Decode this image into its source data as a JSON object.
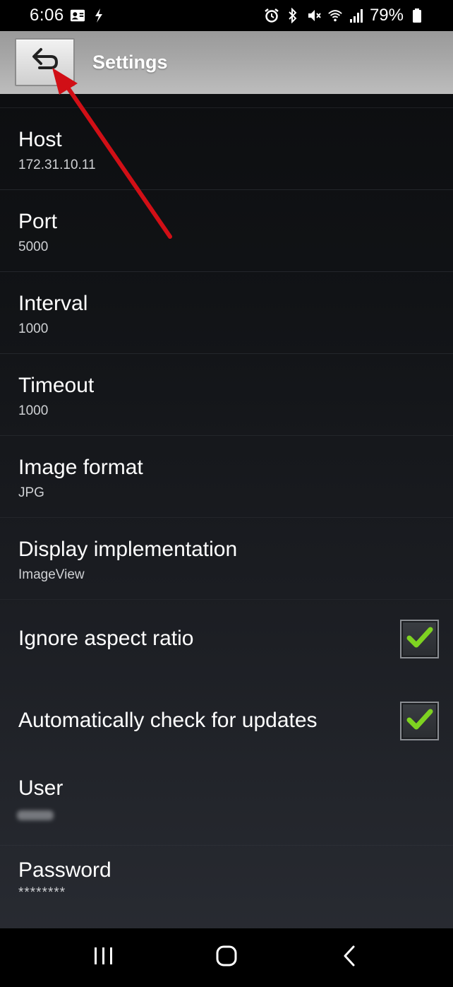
{
  "status_bar": {
    "time": "6:06",
    "battery_percent": "79%",
    "left_icons": [
      "contact-card-icon",
      "charging-bolt-icon"
    ],
    "right_icons": [
      "alarm-icon",
      "bluetooth-icon",
      "mute-icon",
      "wifi-icon",
      "signal-icon",
      "battery-icon"
    ]
  },
  "title_bar": {
    "title": "Settings",
    "back_icon": "back-arrow-icon"
  },
  "settings": [
    {
      "title": "Host",
      "summary": "172.31.10.11"
    },
    {
      "title": "Port",
      "summary": "5000"
    },
    {
      "title": "Interval",
      "summary": "1000"
    },
    {
      "title": "Timeout",
      "summary": "1000"
    },
    {
      "title": "Image format",
      "summary": "JPG"
    },
    {
      "title": "Display implementation",
      "summary": "ImageView"
    },
    {
      "title": "Ignore aspect ratio",
      "checked": true
    },
    {
      "title": "Automatically check for updates",
      "checked": true
    },
    {
      "title": "User",
      "summary_blurred": true
    },
    {
      "title": "Password",
      "summary": "********"
    }
  ],
  "nav_bar": {
    "icons": [
      "recent-apps-icon",
      "home-icon",
      "back-icon"
    ]
  },
  "colors": {
    "accent_check": "#7ed321",
    "annotation_arrow": "#d10f16",
    "title_bar": "#a6a6a6"
  }
}
